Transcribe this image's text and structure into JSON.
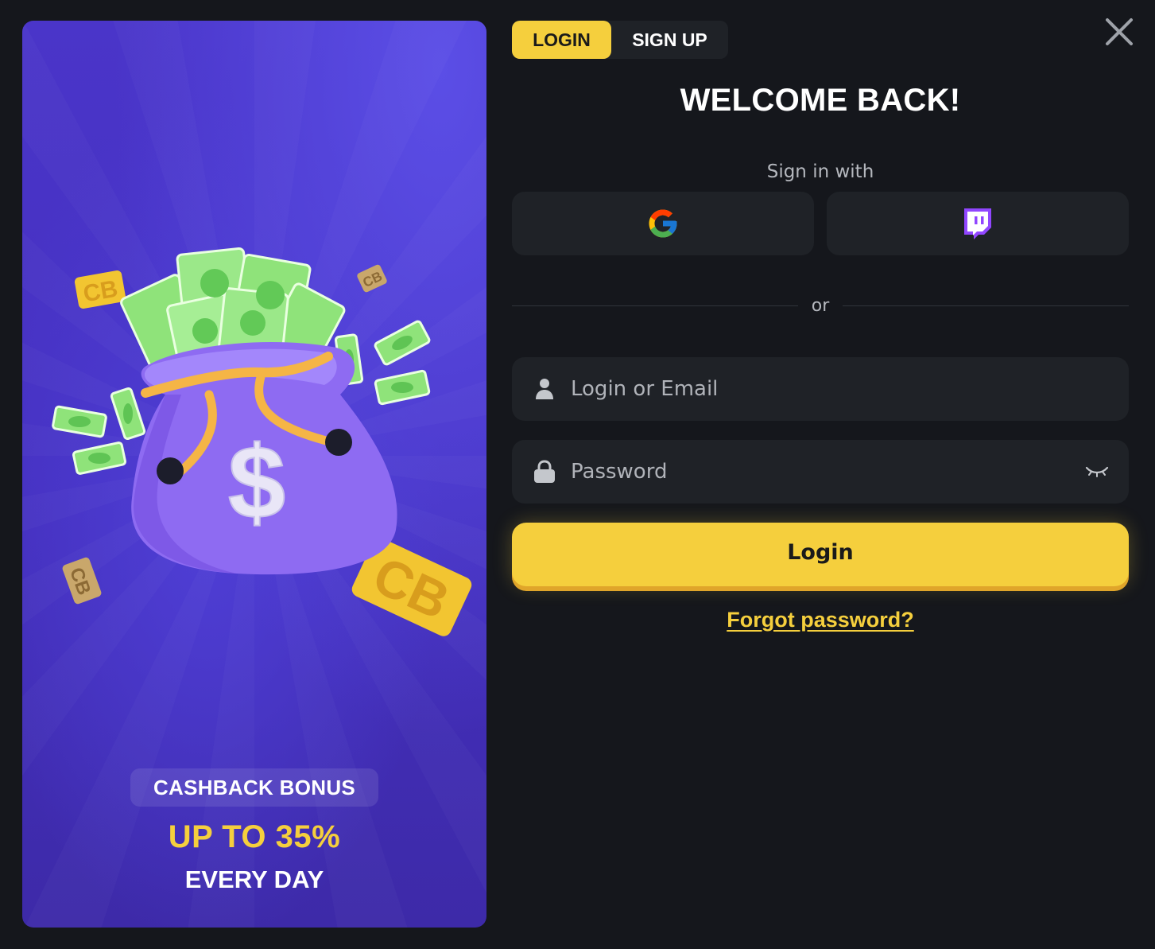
{
  "promo": {
    "chip_label": "CASHBACK BONUS",
    "amount": "UP TO 35%",
    "period": "EVERY DAY",
    "art": {
      "money_bag_icon": "money-bag-illustration",
      "bag_symbol": "$",
      "coin_logo_text": "CB"
    }
  },
  "tabs": [
    {
      "label": "LOGIN",
      "active": true
    },
    {
      "label": "SIGN UP",
      "active": false
    }
  ],
  "close_icon": "close-icon",
  "form": {
    "title": "WELCOME BACK!",
    "sign_in_with": "Sign in with",
    "social": [
      {
        "provider": "google",
        "icon": "google-icon"
      },
      {
        "provider": "twitch",
        "icon": "twitch-icon"
      }
    ],
    "divider_text": "or",
    "login_field": {
      "placeholder": "Login or Email",
      "value": "",
      "icon": "user-icon"
    },
    "password_field": {
      "placeholder": "Password",
      "value": "",
      "icon": "lock-icon",
      "toggle_icon": "eye-closed-icon"
    },
    "submit_label": "Login",
    "forgot_label": "Forgot password?"
  },
  "colors": {
    "background": "#15171c",
    "panel": "#1f2227",
    "accent": "#f5cf3d",
    "promo_purple": "#4a35c9",
    "twitch": "#9146ff"
  }
}
